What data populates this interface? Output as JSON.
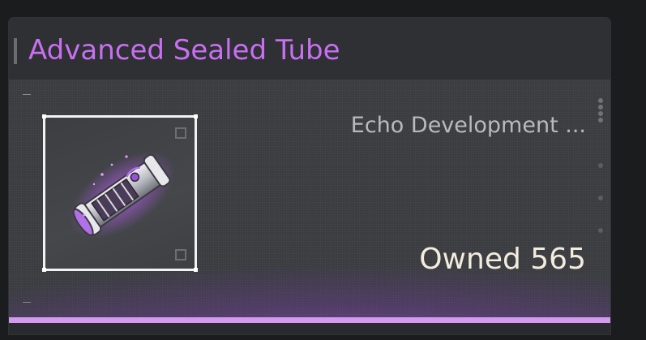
{
  "card": {
    "title": "Advanced Sealed Tube",
    "item_category": "Echo Development ...",
    "owned_label": "Owned",
    "owned_count": "565",
    "icon": "sealed-tube-icon",
    "colors": {
      "title": "#c86ff2",
      "accent_glow": "#a050d2",
      "bottom_line": "#d29bf0",
      "owned_text": "#f3ecdf"
    }
  }
}
